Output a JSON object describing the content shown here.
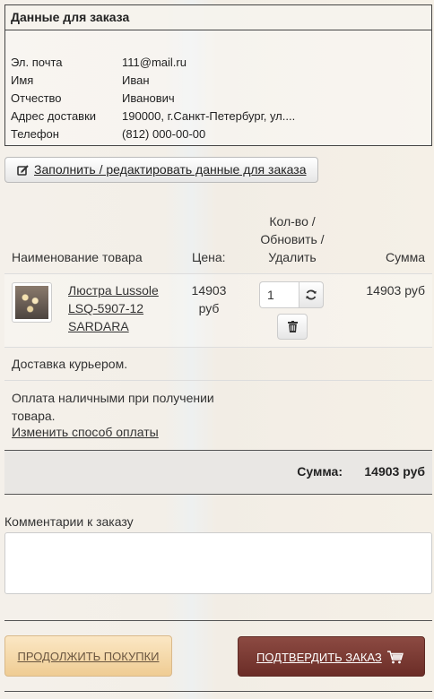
{
  "order_data": {
    "title": "Данные для заказа",
    "fields": [
      {
        "label": "Эл. почта",
        "value": "111@mail.ru"
      },
      {
        "label": "Имя",
        "value": "Иван"
      },
      {
        "label": "Отчество",
        "value": "Иванович"
      },
      {
        "label": "Адрес доставки",
        "value": "190000, г.Санкт-Петербург, ул...."
      },
      {
        "label": "Телефон",
        "value": "(812) 000-00-00"
      }
    ],
    "edit_button": "Заполнить / редактировать данные для заказа"
  },
  "cart_table": {
    "headers": {
      "name": "Наименование товара",
      "price": "Цена:",
      "qty_line1": "Кол-во /",
      "qty_line2": "Обновить /",
      "qty_line3": "Удалить",
      "sum": "Сумма"
    },
    "item": {
      "name_line1": "Люстра Lussole",
      "name_line2": "LSQ-5907-12",
      "name_line3": "SARDARA",
      "price_line1": "14903",
      "price_line2": "руб",
      "quantity": "1",
      "sum": "14903 руб"
    }
  },
  "delivery": {
    "text": "Доставка курьером."
  },
  "payment": {
    "line1": "Оплата наличными при получении",
    "line2": "товара.",
    "change_link": "Изменить способ оплаты"
  },
  "total": {
    "label": "Сумма:",
    "value": "14903 руб"
  },
  "comments": {
    "label": "Комментарии к заказу",
    "value": ""
  },
  "actions": {
    "continue": "ПРОДОЛЖИТЬ ПОКУПКИ",
    "confirm": "ПОДТВЕРДИТЬ ЗАКАЗ"
  },
  "icons": {
    "edit": "edit-icon",
    "refresh": "refresh-icon",
    "delete": "trash-icon",
    "cart": "cart-icon"
  },
  "colors": {
    "confirm_bg": "#7a3a33",
    "continue_bg": "#f4d7a6"
  }
}
